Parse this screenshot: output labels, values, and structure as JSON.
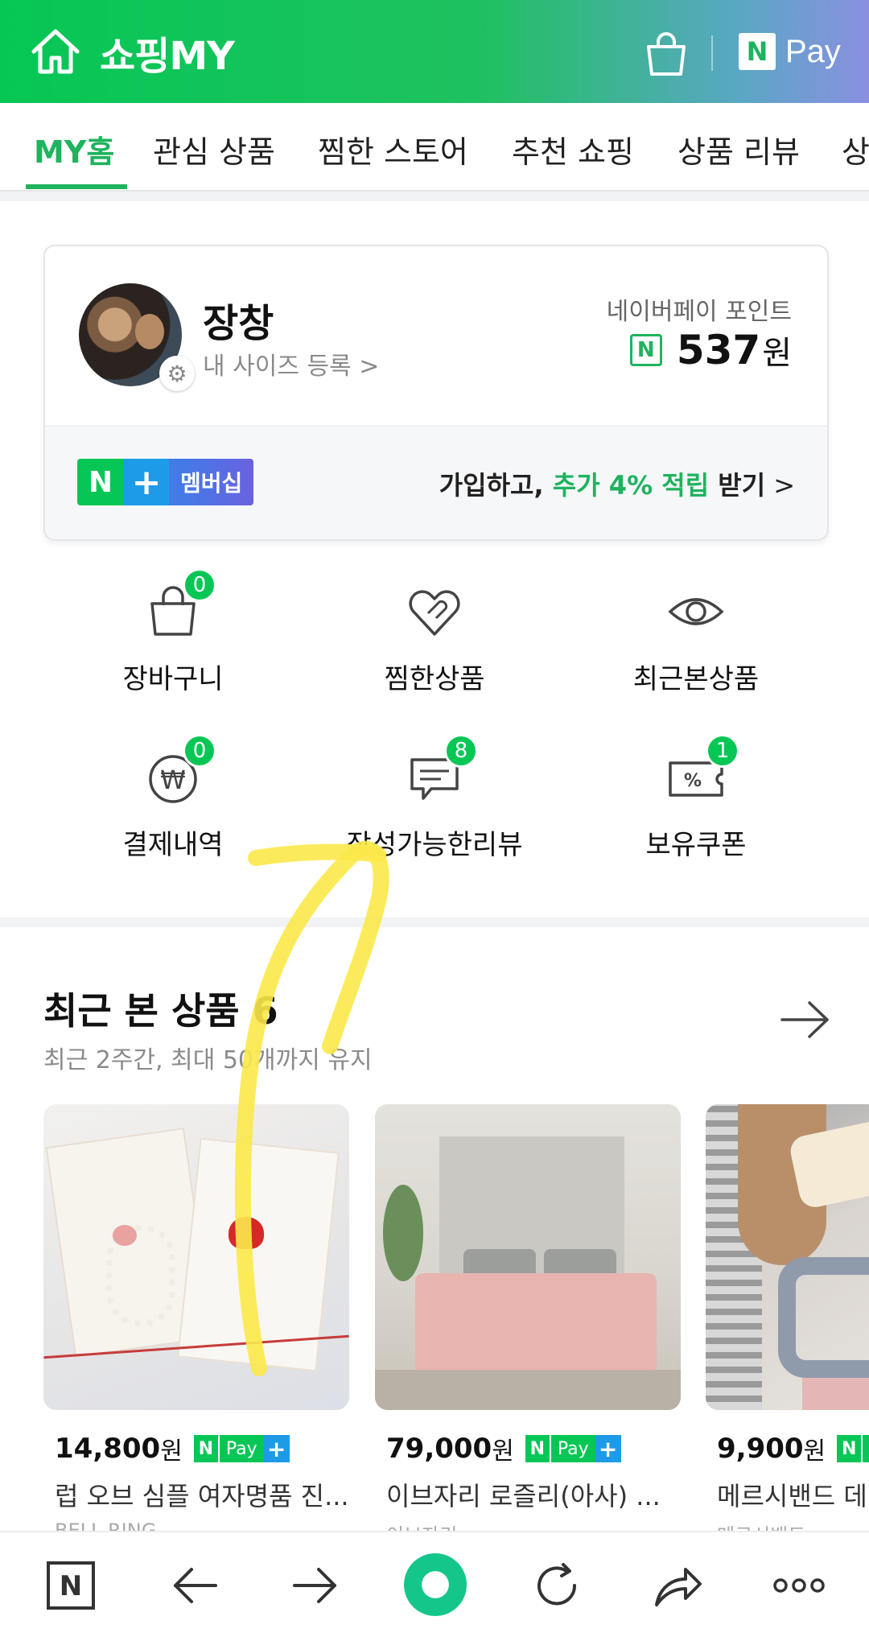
{
  "header": {
    "title": "쇼핑MY",
    "pay_n": "N",
    "pay_label": "Pay"
  },
  "tabs": [
    {
      "label": "MY홈",
      "active": true
    },
    {
      "label": "관심 상품"
    },
    {
      "label": "찜한 스토어"
    },
    {
      "label": "추천 쇼핑"
    },
    {
      "label": "상품 리뷰"
    },
    {
      "label": "상"
    }
  ],
  "profile": {
    "name": "장창",
    "size_link": "내 사이즈 등록 >",
    "point_label": "네이버페이 포인트",
    "point_icon": "N",
    "point_value": "537",
    "point_unit": "원",
    "membership_n": "N",
    "membership_plus": "+",
    "membership_label": "멤버십",
    "join_pre": "가입하고, ",
    "join_highlight": "추가 4% 적립",
    "join_post": " 받기",
    "join_chevron": ">"
  },
  "quick_menu": [
    {
      "label": "장바구니",
      "icon": "cart-icon",
      "badge": "0"
    },
    {
      "label": "찜한상품",
      "icon": "heart-icon",
      "badge": ""
    },
    {
      "label": "최근본상품",
      "icon": "eye-icon",
      "badge": ""
    },
    {
      "label": "결제내역",
      "icon": "won-icon",
      "badge": "0"
    },
    {
      "label": "작성가능한리뷰",
      "icon": "review-icon",
      "badge": "8"
    },
    {
      "label": "보유쿠폰",
      "icon": "coupon-icon",
      "badge": "1"
    }
  ],
  "recent": {
    "title": "최근 본 상품 6",
    "subtitle": "최근 2주간, 최대 50개까지 유지"
  },
  "products": [
    {
      "price": "14,800",
      "unit": "원",
      "name": "럽 오브 심플 여자명품 진...",
      "store": "BELL RING"
    },
    {
      "price": "79,000",
      "unit": "원",
      "name": "이브자리 로즐리(아사) ...",
      "store": "이브자리"
    },
    {
      "price": "9,900",
      "unit": "원",
      "name": "메르시밴드 데일리 헤어집게",
      "store": "메르시밴드"
    }
  ],
  "npay_badge": {
    "n": "N",
    "pay": "Pay",
    "plus": "+"
  },
  "bottom_bar": {
    "n_label": "N"
  },
  "colors": {
    "accent": "#1fb35e",
    "naver_green": "#06c755",
    "plus_blue": "#1e9be8",
    "annotation": "#fbe94a"
  }
}
